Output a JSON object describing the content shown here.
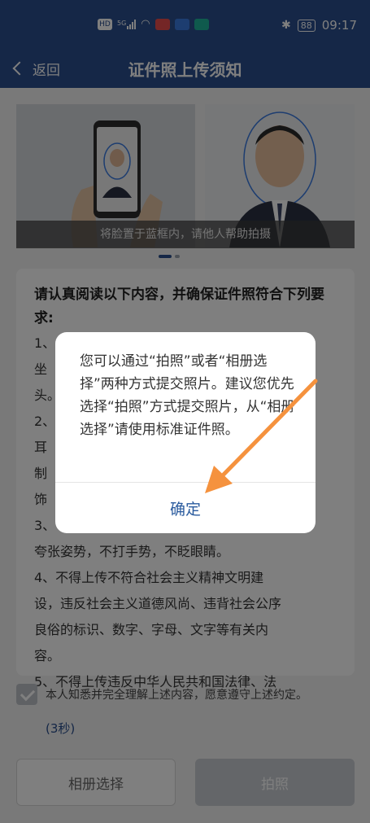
{
  "status_bar": {
    "icons": [
      "hd-icon",
      "signal-icon",
      "wifi-icon",
      "app-red-icon",
      "app-blue-icon",
      "app-teal-icon"
    ],
    "left_labels": [
      "HD",
      "5G"
    ],
    "time": "09:17",
    "battery": "88",
    "bluetooth_icon": "bluetooth-icon"
  },
  "nav": {
    "back_label": "返回",
    "title": "证件照上传须知"
  },
  "photo": {
    "caption": "将脸置于蓝框内，请他人帮助拍摄"
  },
  "requirements": {
    "title": "请认真阅读以下内容，并确保证件照符合下列要求:",
    "items": [
      "1、",
      "坐",
      "头。",
      "2、",
      "耳",
      "制",
      "饰",
      "3、",
      "夸张姿势，不打手势，不眨眼睛。",
      "4、不得上传不符合社会主义精神文明建",
      "设，违反社会主义道德风尚、违背社会公序",
      "良俗的标识、数字、字母、文字等有关内",
      "容。",
      "5、不得上传违反中华人民共和国法律、法"
    ]
  },
  "agreement": {
    "text": "本人知悉并完全理解上述内容，愿意遵守上述约定。",
    "countdown": "(3秒)"
  },
  "buttons": {
    "album": "相册选择",
    "camera": "拍照"
  },
  "dialog": {
    "message": "您可以通过“拍照”或者“相册选择”两种方式提交照片。建议您优先选择“拍照”方式提交照片，从“相册选择”请使用标准证件照。",
    "ok": "确定"
  },
  "colors": {
    "header": "#2a4f8e",
    "accent_blue": "#2a5b9e",
    "arrow": "#f5923e"
  }
}
